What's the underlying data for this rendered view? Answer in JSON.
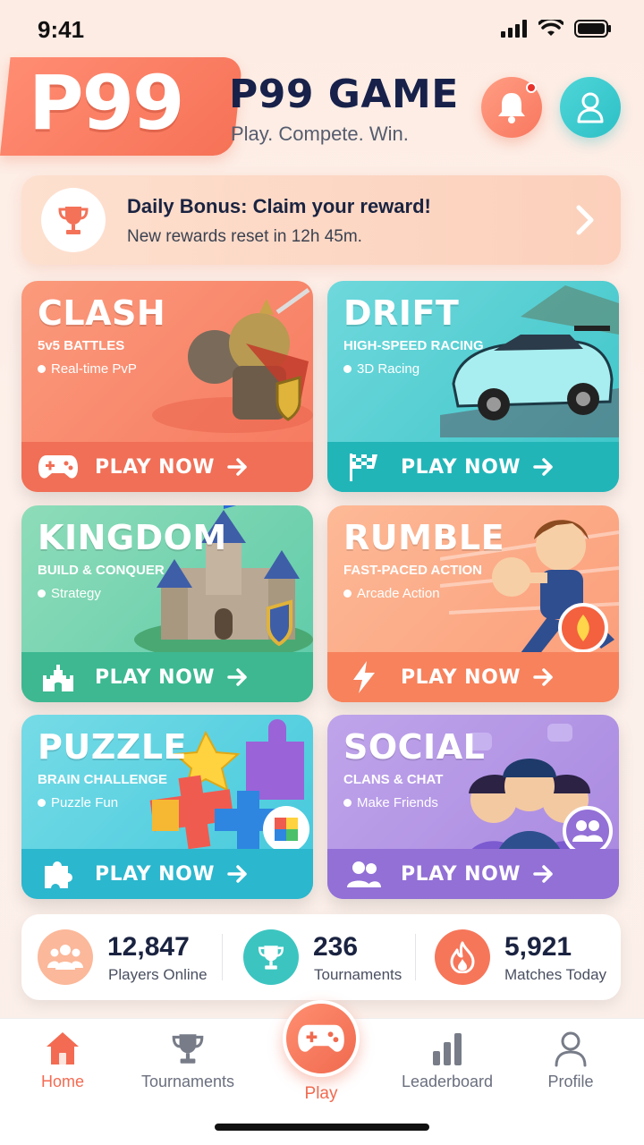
{
  "status_bar": {
    "time": "9:41"
  },
  "header": {
    "logo": "P99",
    "title": "P99 GAME",
    "subtitle": "Play. Compete. Win."
  },
  "bonus": {
    "title": "Daily Bonus: Claim your reward!",
    "subtitle": "New rewards reset in 12h 45m."
  },
  "games": [
    {
      "title": "CLASH",
      "subtitle": "5v5 BATTLES",
      "tag": "Real-time PvP",
      "cta": "PLAY NOW",
      "color": "#f8826a",
      "bar_color": "#f06f56",
      "icon": "gamepad-icon"
    },
    {
      "title": "DRIFT",
      "subtitle": "HIGH-SPEED RACING",
      "tag": "3D Racing",
      "cta": "PLAY NOW",
      "color": "#3cc8c8",
      "bar_color": "#22b5b8",
      "icon": "checkered-flag-icon"
    },
    {
      "title": "KINGDOM",
      "subtitle": "BUILD & CONQUER",
      "tag": "Strategy",
      "cta": "PLAY NOW",
      "color": "#5dcaa8",
      "bar_color": "#3db891",
      "icon": "castle-icon"
    },
    {
      "title": "RUMBLE",
      "subtitle": "FAST-PACED ACTION",
      "tag": "Arcade Action",
      "cta": "PLAY NOW",
      "color": "#fb9c78",
      "bar_color": "#f7825c",
      "icon": "lightning-icon"
    },
    {
      "title": "PUZZLE",
      "subtitle": "BRAIN CHALLENGE",
      "tag": "Puzzle Fun",
      "cta": "PLAY NOW",
      "color": "#42c8dc",
      "bar_color": "#2bb7ce",
      "icon": "puzzle-piece-icon"
    },
    {
      "title": "SOCIAL",
      "subtitle": "CLANS & CHAT",
      "tag": "Make Friends",
      "cta": "PLAY NOW",
      "color": "#a888e0",
      "bar_color": "#9270d6",
      "icon": "users-icon"
    }
  ],
  "stats": [
    {
      "value": "12,847",
      "label": "Players Online",
      "icon": "users-icon",
      "color": "#fbb89a"
    },
    {
      "value": "236",
      "label": "Tournaments",
      "icon": "trophy-icon",
      "color": "#3cc5c0"
    },
    {
      "value": "5,921",
      "label": "Matches Today",
      "icon": "flame-icon",
      "color": "#f6765a"
    }
  ],
  "tabs": [
    {
      "label": "Home",
      "icon": "home-icon"
    },
    {
      "label": "Tournaments",
      "icon": "trophy-icon"
    },
    {
      "label": "Play",
      "icon": "gamepad-icon"
    },
    {
      "label": "Leaderboard",
      "icon": "bar-chart-icon"
    },
    {
      "label": "Profile",
      "icon": "person-icon"
    }
  ]
}
